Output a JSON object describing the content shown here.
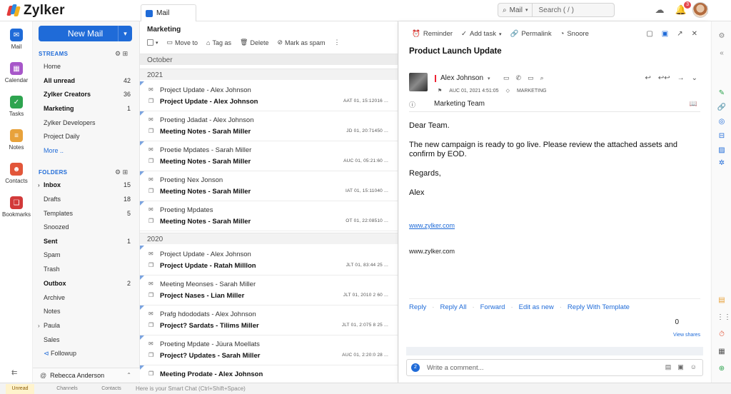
{
  "app": {
    "name": "Zylker",
    "tab": "Mail"
  },
  "search": {
    "scope": "Mail",
    "placeholder": "Search ( / )"
  },
  "notifications": {
    "count": "3"
  },
  "rail": [
    {
      "label": "Mail",
      "icon": "mail-icon",
      "color": "#1f6bd8"
    },
    {
      "label": "Calendar",
      "icon": "calendar-icon",
      "color": "#a757c9"
    },
    {
      "label": "Tasks",
      "icon": "tasks-icon",
      "color": "#2ea44f"
    },
    {
      "label": "Notes",
      "icon": "notes-icon",
      "color": "#e8a23b"
    },
    {
      "label": "Contacts",
      "icon": "contacts-icon",
      "color": "#e2563a"
    },
    {
      "label": "Bookmarks",
      "icon": "bookmarks-icon",
      "color": "#d23a3a"
    }
  ],
  "folders_pane": {
    "new_mail": "New Mail",
    "streams_title": "STREAMS",
    "streams": [
      {
        "label": "Home",
        "count": ""
      },
      {
        "label": "All unread",
        "count": "42",
        "bold": true
      },
      {
        "label": "Zylker Creators",
        "count": "36",
        "bold": true
      },
      {
        "label": "Marketing",
        "count": "1",
        "bold": true
      },
      {
        "label": "Zylker Developers",
        "count": ""
      },
      {
        "label": "Project Daily",
        "count": ""
      },
      {
        "label": "More ..",
        "count": "",
        "more": true
      }
    ],
    "folders_title": "FOLDERS",
    "folders": [
      {
        "label": "Inbox",
        "count": "15",
        "bold": true,
        "caret": true
      },
      {
        "label": "Drafts",
        "count": "18"
      },
      {
        "label": "Templates",
        "count": "5"
      },
      {
        "label": "Snoozed",
        "count": ""
      },
      {
        "label": "Sent",
        "count": "1",
        "bold": true
      },
      {
        "label": "Spam",
        "count": ""
      },
      {
        "label": "Trash",
        "count": ""
      },
      {
        "label": "Outbox",
        "count": "2",
        "bold": true
      },
      {
        "label": "Archive",
        "count": ""
      },
      {
        "label": "Notes",
        "count": ""
      },
      {
        "label": "Paula",
        "count": "",
        "caret": true
      },
      {
        "label": "Sales",
        "count": ""
      },
      {
        "label": "Followup",
        "count": ""
      }
    ],
    "user": "Rebecca Anderson"
  },
  "mail_list": {
    "title": "Marketing",
    "tools": [
      "Move to",
      "Tag as",
      "Delete",
      "Mark as spam"
    ],
    "month": "October",
    "groups": [
      {
        "year": "2021",
        "rows": [
          {
            "l1": "Project Update - Alex Johnson",
            "l2": "Project Update - Alex Johnson",
            "date": "AAT 01, 15:12016 ..."
          },
          {
            "l1": "Proeting Jdadat - Alex Johnson",
            "l2": "Meeting Notes - Sarah Miller",
            "date": "JD 01, 20:71450 ..."
          },
          {
            "l1": "Proetie Mpdates - Sarah Miller",
            "l2": "Meeting Notes - Sarah Miller",
            "date": "AUC 01, 05:21:60 ..."
          },
          {
            "l1": "Proeting Nex Jonson",
            "l2": "Meeting Notes - Sarah Miller",
            "date": "IAT 01, 15:11040 ..."
          },
          {
            "l1": "Proeting Mpdates",
            "l2": "Meeting Notes - Sarah Miller",
            "date": "OT 01, 22:08510 ..."
          }
        ]
      },
      {
        "year": "2020",
        "rows": [
          {
            "l1": "Project Update - Alex Johnson",
            "l2": "Project  Update - Ratah Milllon",
            "date": "JLT 01, 83:44 25 ..."
          },
          {
            "l1": "Meeting Meonses - Sarah Miller",
            "l2": "Project Nases - Lian Miller",
            "date": "JLT 01, 2010 2 60 ..."
          },
          {
            "l1": "Prafg hdododats - Alex Johnson",
            "l2": "Project? Sardats - Tilims Miller",
            "date": "JLT 01, 2:075 8 25 ..."
          },
          {
            "l1": "Proeting Mpdate - Jüura Moellats",
            "l2": "Project? Updates - Sarah Miller",
            "date": "AUC 01, 2:20:0 28 ..."
          },
          {
            "l1": "Meeting Prodate - Alex Johnson",
            "l2": "",
            "date": ""
          }
        ]
      }
    ]
  },
  "reading": {
    "tools": [
      "Reminder",
      "Add task",
      "Permalink",
      "Snoore"
    ],
    "subject": "Product Launch Update",
    "sender": "Alex Johnson",
    "meta_date": "AUC 01, 2021 4:51:05",
    "meta_tag": "MARKETING",
    "to": "Marketing Team",
    "body": [
      "Dear Team.",
      "The new campaign is ready to go live. Please review the attached assets and confirm by EOD.",
      "Regards,",
      "Alex"
    ],
    "link": "www.zylker.com",
    "signature": "www.zylker.com",
    "reply_actions": [
      "Reply",
      "Reply All",
      "Forward",
      "Edit as new",
      "Reply With Template"
    ],
    "shares_count": "0",
    "view_shares": "View shares",
    "comment_placeholder": "Write a comment...",
    "comment_badge": "2"
  },
  "bottom": {
    "smart_chat": "Here is your Smart Chat (Ctrl+Shift+Space)",
    "items": [
      "Unread Chats",
      "Channels",
      "Contacts"
    ]
  }
}
